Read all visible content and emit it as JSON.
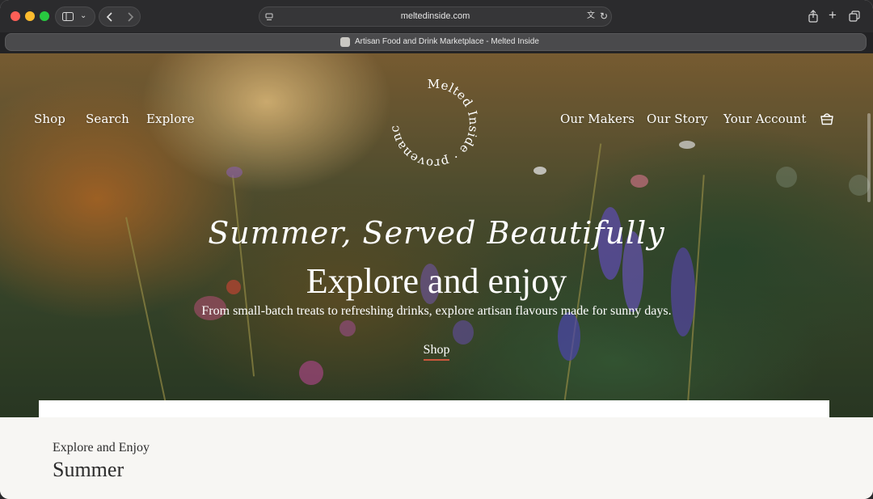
{
  "browser": {
    "url": "meltedinside.com",
    "tab_title": "Artisan Food and Drink Marketplace - Melted Inside"
  },
  "nav": {
    "left": [
      "Shop",
      "Search",
      "Explore"
    ],
    "right": [
      "Our Makers",
      "Our Story",
      "Your Account"
    ],
    "cart_icon": "basket-icon"
  },
  "logo": {
    "ring_text": "Melted Inside · provenance matters ·"
  },
  "hero": {
    "script_heading": "Summer, Served Beautifully",
    "title": "Explore and enjoy",
    "subtitle": "From small-batch treats to refreshing drinks, explore artisan flavours made for sunny days.",
    "cta": "Shop"
  },
  "section": {
    "kicker": "Explore and Enjoy",
    "title": "Summer"
  },
  "colors": {
    "accent_underline": "#c9573c",
    "page_background": "#f7f6f3"
  }
}
